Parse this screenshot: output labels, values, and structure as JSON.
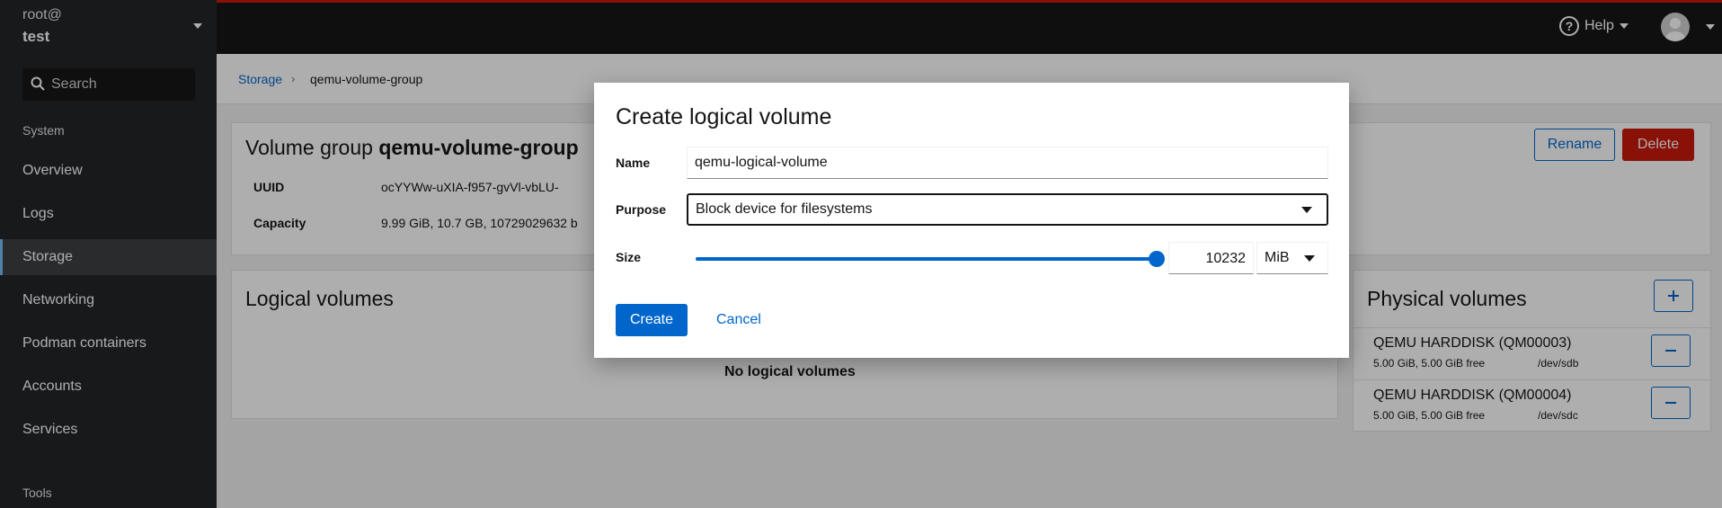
{
  "host": {
    "user": "root@",
    "name": "test"
  },
  "search": {
    "placeholder": "Search"
  },
  "nav": {
    "section_system": "System",
    "items": [
      "Overview",
      "Logs",
      "Storage",
      "Networking",
      "Podman containers",
      "Accounts",
      "Services"
    ],
    "active": "Storage",
    "section_tools": "Tools"
  },
  "topbar": {
    "help_label": "Help"
  },
  "breadcrumb": {
    "root": "Storage",
    "current": "qemu-volume-group"
  },
  "volume_group": {
    "title_prefix": "Volume group",
    "title_name": "qemu-volume-group",
    "uuid_label": "UUID",
    "uuid_value": "ocYYWw-uXIA-f957-gvVl-vbLU-",
    "capacity_label": "Capacity",
    "capacity_value": "9.99 GiB, 10.7 GB, 10729029632 b",
    "rename_label": "Rename",
    "delete_label": "Delete"
  },
  "logical_volumes": {
    "title": "Logical volumes",
    "empty": "No logical volumes"
  },
  "physical_volumes": {
    "title": "Physical volumes",
    "items": [
      {
        "name": "QEMU HARDDISK (QM00003)",
        "size": "5.00 GiB, 5.00 GiB free",
        "device": "/dev/sdb"
      },
      {
        "name": "QEMU HARDDISK (QM00004)",
        "size": "5.00 GiB, 5.00 GiB free",
        "device": "/dev/sdc"
      }
    ]
  },
  "dialog": {
    "title": "Create logical volume",
    "name_label": "Name",
    "name_value": "qemu-logical-volume",
    "purpose_label": "Purpose",
    "purpose_value": "Block device for filesystems",
    "size_label": "Size",
    "size_value": "10232",
    "size_unit": "MiB",
    "slider_fraction": 1.0,
    "create_label": "Create",
    "cancel_label": "Cancel"
  },
  "colors": {
    "accent": "#0066cc",
    "danger": "#c9190b",
    "sidebar": "#212427",
    "topbar": "#151515"
  }
}
